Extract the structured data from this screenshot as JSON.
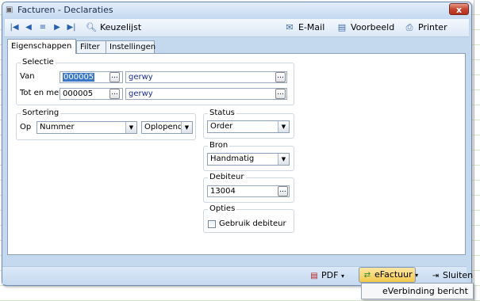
{
  "window": {
    "title": "Facturen - Declaraties",
    "close_label": "x"
  },
  "toolbar": {
    "nav": [
      {
        "name": "first-record-icon",
        "glyph": "⏮"
      },
      {
        "name": "previous-record-icon",
        "glyph": "◀"
      },
      {
        "name": "list-icon",
        "glyph": "≡"
      },
      {
        "name": "next-record-icon",
        "glyph": "▶"
      },
      {
        "name": "last-record-icon",
        "glyph": "⏭"
      }
    ],
    "keuzelijst": "Keuzelijst",
    "email": "E-Mail",
    "voorbeeld": "Voorbeeld",
    "printer": "Printer"
  },
  "tabs": [
    {
      "label": "Eigenschappen",
      "active": true
    },
    {
      "label": "Filter",
      "active": false
    },
    {
      "label": "Instellingen",
      "active": false
    }
  ],
  "selectie": {
    "title": "Selectie",
    "van_label": "Van",
    "van_code": "000005",
    "van_name": "gerwy",
    "tot_label": "Tot en met",
    "tot_code": "000005",
    "tot_name": "gerwy",
    "dots": "..."
  },
  "sortering": {
    "title": "Sortering",
    "op_label": "Op",
    "field_value": "Nummer",
    "order_value": "Oplopend"
  },
  "status": {
    "title": "Status",
    "value": "Order"
  },
  "bron": {
    "title": "Bron",
    "value": "Handmatig"
  },
  "debiteur": {
    "title": "Debiteur",
    "value": "13004"
  },
  "opties": {
    "title": "Opties",
    "checkbox_label": "Gebruik debiteur",
    "checked": false
  },
  "bottom": {
    "pdf": "PDF",
    "efactuur": "eFactuur",
    "sluiten": "Sluiten",
    "caret": "▾"
  },
  "dropdown": {
    "item": "eVerbinding bericht"
  }
}
